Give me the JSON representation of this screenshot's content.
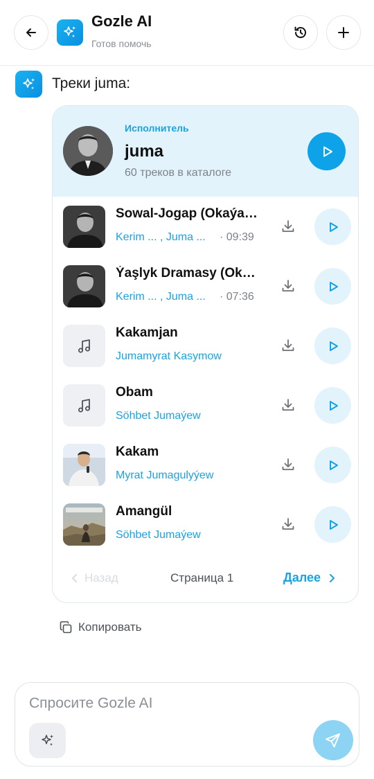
{
  "header": {
    "title": "Gozle AI",
    "subtitle": "Готов помочь"
  },
  "message": {
    "text": "Треки juma:"
  },
  "artist": {
    "role": "Исполнитель",
    "name": "juma",
    "count": "60 треков в каталоге"
  },
  "tracks": [
    {
      "title": "Sowal-Jogap (Okaýan: Kerim ...)",
      "artist": "Kerim ... , Juma ...",
      "duration": "· 09:39",
      "thumb": "photo-bw"
    },
    {
      "title": "Ýaşlyk Dramasy (Okaýan: ...)",
      "artist": "Kerim ... , Juma ...",
      "duration": "· 07:36",
      "thumb": "photo-bw"
    },
    {
      "title": "Kakamjan",
      "artist": "Jumamyrat Kasymow",
      "duration": "",
      "thumb": "music-note-icon"
    },
    {
      "title": "Obam",
      "artist": "Söhbet Jumaýew",
      "duration": "",
      "thumb": "music-note-icon"
    },
    {
      "title": "Kakam",
      "artist": "Myrat Jumagulyýew",
      "duration": "",
      "thumb": "photo-color"
    },
    {
      "title": "Amangül",
      "artist": "Söhbet Jumaýew",
      "duration": "",
      "thumb": "album-cover"
    }
  ],
  "pager": {
    "prev": "Назад",
    "page": "Страница 1",
    "next": "Далее"
  },
  "copy": "Копировать",
  "input": {
    "placeholder": "Спросите Gozle AI"
  },
  "colors": {
    "accent": "#0ea2e8",
    "accent_text": "#1aa3e3",
    "artist_bg": "#e3f3fc",
    "send_disabled": "#8dd3f4"
  }
}
